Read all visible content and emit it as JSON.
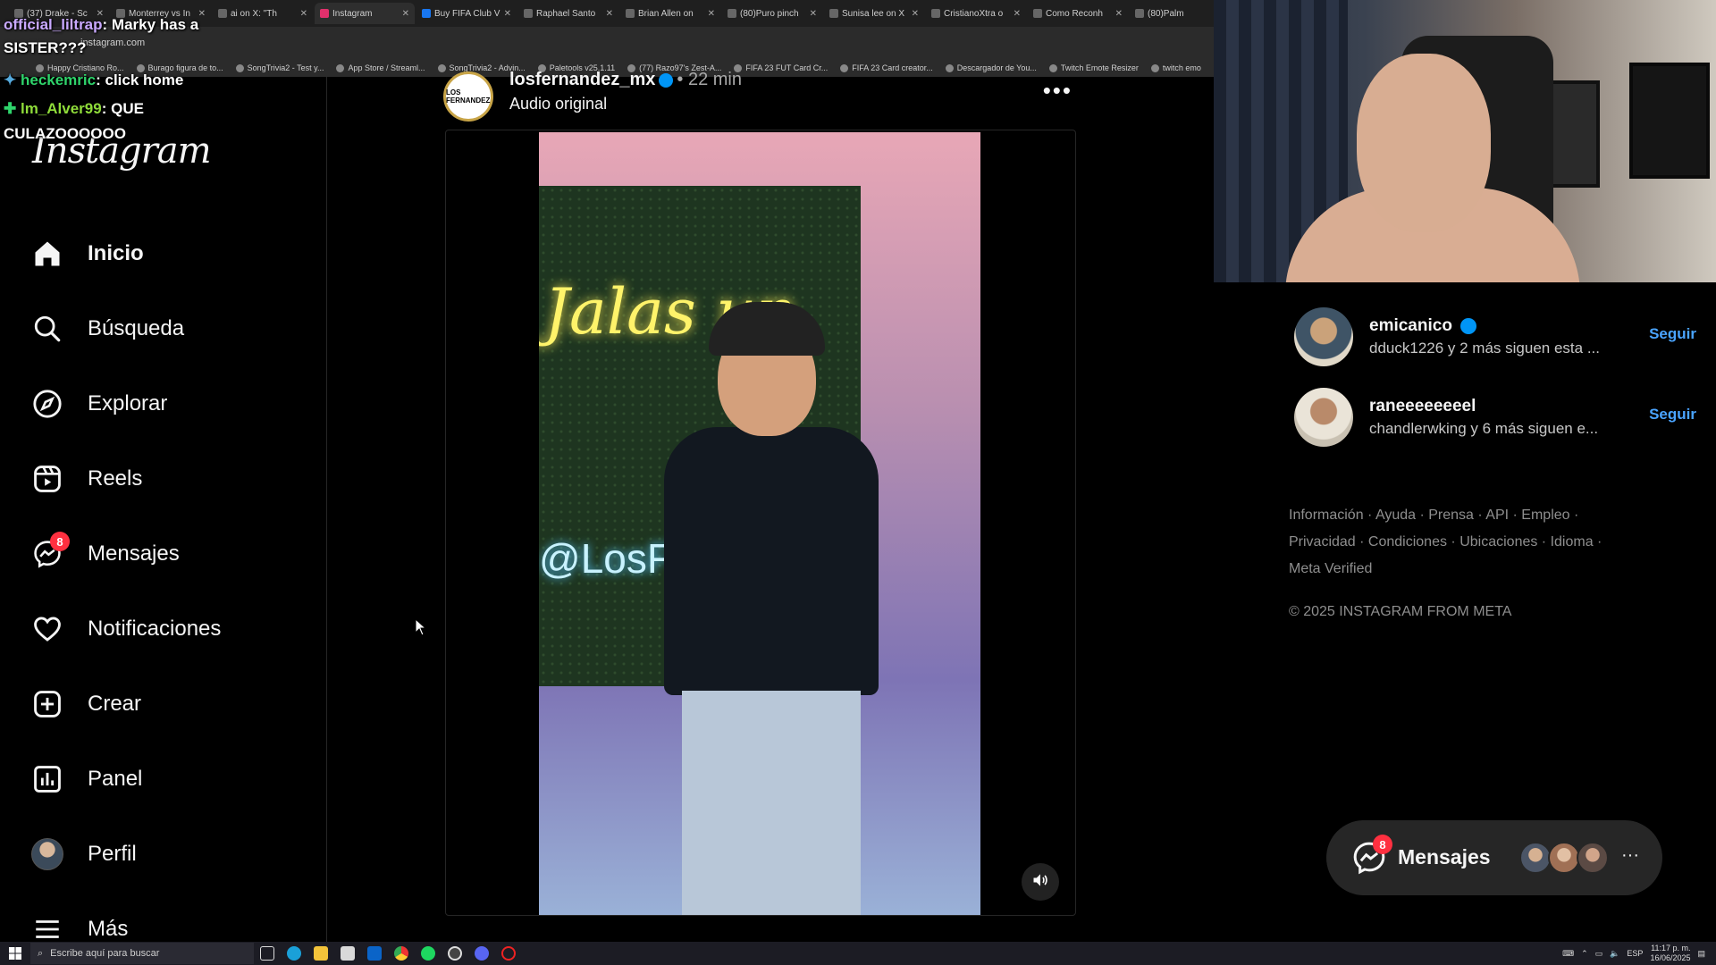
{
  "browser": {
    "tabs": [
      {
        "label": "(37) Drake - Sc"
      },
      {
        "label": "Monterrey vs In"
      },
      {
        "label": "ai on X: \"Th"
      },
      {
        "label": "Instagram",
        "active": true
      },
      {
        "label": "Buy FIFA Club V"
      },
      {
        "label": "Raphael Santo"
      },
      {
        "label": "Brian Allen on"
      },
      {
        "label": "(80)Puro pinch"
      },
      {
        "label": "Sunisa lee on X"
      },
      {
        "label": "CristianoXtra o"
      },
      {
        "label": "Como Reconh"
      },
      {
        "label": "(80)Palm"
      }
    ],
    "address": "instagram.com",
    "bookmarks": [
      "Happy Cristiano Ro...",
      "Burago figura de to...",
      "SongTrivia2 - Test y...",
      "App Store / Streaml...",
      "SongTrivia2 - Advin...",
      "Paletools v25.1.11",
      "(77) Razo97's Zest-A...",
      "FIFA 23 FUT Card Cr...",
      "FIFA 23 Card creator...",
      "Descargador de You...",
      "Twitch Emote Resizer",
      "twitch emo"
    ]
  },
  "chat": [
    {
      "user": "official_liltrap",
      "text": ": Marky has a"
    },
    {
      "user": "",
      "text": "SISTER???"
    },
    {
      "user": "heckemric",
      "text": ": click home"
    },
    {
      "user": "lm_Alver99",
      "text": ": QUE"
    },
    {
      "user": "",
      "text": "CULAZOOOOOO"
    }
  ],
  "sidebar": {
    "logo": "Instagram",
    "items": [
      {
        "label": "Inicio",
        "icon": "home-icon"
      },
      {
        "label": "Búsqueda",
        "icon": "search-icon"
      },
      {
        "label": "Explorar",
        "icon": "compass-icon"
      },
      {
        "label": "Reels",
        "icon": "reels-icon"
      },
      {
        "label": "Mensajes",
        "icon": "messenger-icon",
        "badge": "8"
      },
      {
        "label": "Notificaciones",
        "icon": "heart-icon"
      },
      {
        "label": "Crear",
        "icon": "plus-square-icon"
      },
      {
        "label": "Panel",
        "icon": "chart-icon"
      },
      {
        "label": "Perfil",
        "icon": "avatar"
      },
      {
        "label": "Más",
        "icon": "menu-icon"
      }
    ]
  },
  "post": {
    "username": "losfernandez_mx",
    "time": "22 min",
    "audio": "Audio original",
    "avatar_text": "LOS FERNANDEZ",
    "video_text_1": "Jalas un",
    "video_text_2": "@LosFernan"
  },
  "suggestions": [
    {
      "name": "emicanico",
      "verified": true,
      "sub": "dduck1226 y 2 más siguen esta ...",
      "action": "Seguir"
    },
    {
      "name": "raneeeeeeeel",
      "verified": false,
      "sub": "chandlerwking y 6 más siguen e...",
      "action": "Seguir"
    }
  ],
  "footer": {
    "links": [
      "Información",
      "Ayuda",
      "Prensa",
      "API",
      "Empleo",
      "Privacidad",
      "Condiciones",
      "Ubicaciones",
      "Idioma",
      "Meta Verified"
    ],
    "copyright": "© 2025 INSTAGRAM FROM META"
  },
  "messages_pill": {
    "label": "Mensajes",
    "badge": "8"
  },
  "taskbar": {
    "search_placeholder": "Escribe aquí para buscar",
    "lang": "ESP",
    "time": "11:17 p. m.",
    "date": "16/06/2025"
  },
  "colors": {
    "accent": "#0095f6",
    "follow": "#4aa4ff",
    "badge": "#ff3040"
  }
}
